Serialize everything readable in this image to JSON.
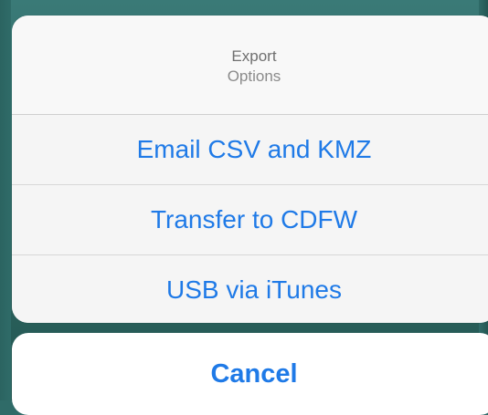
{
  "action_sheet": {
    "title": "Export",
    "subtitle": "Options",
    "actions": [
      {
        "label": "Email CSV and KMZ"
      },
      {
        "label": "Transfer to CDFW"
      },
      {
        "label": "USB via iTunes"
      }
    ],
    "cancel_label": "Cancel"
  },
  "colors": {
    "accent": "#1f7ae7",
    "backdrop": "#2f6b68",
    "sheet_bg": "#f5f5f5",
    "cancel_bg": "#ffffff",
    "title_text": "#6f6f6f"
  }
}
